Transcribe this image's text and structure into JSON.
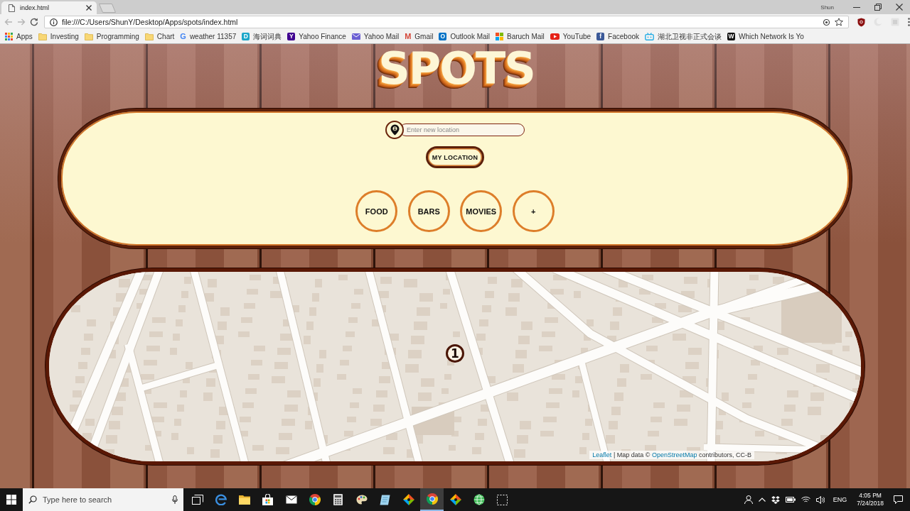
{
  "browser": {
    "tab": {
      "title": "index.html"
    },
    "profile": "Shun",
    "address": "file:///C:/Users/ShunY/Desktop/Apps/spots/index.html",
    "bookmarks": [
      {
        "label": "Apps",
        "kind": "grid"
      },
      {
        "label": "Investing",
        "kind": "folder"
      },
      {
        "label": "Programming",
        "kind": "folder"
      },
      {
        "label": "Chart",
        "kind": "folder"
      },
      {
        "label": "weather 11357",
        "kind": "letter",
        "glyph": "G",
        "color": "#4285f4"
      },
      {
        "label": "海词词典",
        "kind": "tile",
        "glyph": "D",
        "color": "#1ba6c9"
      },
      {
        "label": "Yahoo Finance",
        "kind": "tile",
        "glyph": "Y",
        "color": "#400090"
      },
      {
        "label": "Yahoo Mail",
        "kind": "envelope",
        "color": "#6b5fd3"
      },
      {
        "label": "Gmail",
        "kind": "letter",
        "glyph": "M",
        "color": "#d44638"
      },
      {
        "label": "Outlook Mail",
        "kind": "tile",
        "glyph": "O",
        "color": "#0072c6"
      },
      {
        "label": "Baruch Mail",
        "kind": "squares"
      },
      {
        "label": "YouTube",
        "kind": "play",
        "color": "#e62117"
      },
      {
        "label": "Facebook",
        "kind": "tile",
        "glyph": "f",
        "color": "#3b5998"
      },
      {
        "label": "湖北卫视非正式会谈",
        "kind": "tv",
        "color": "#23ade5"
      },
      {
        "label": "Which Network Is Yo",
        "kind": "tile",
        "glyph": "W",
        "color": "#111111"
      }
    ]
  },
  "page": {
    "title": "SPOTS",
    "search": {
      "placeholder": "Enter new location"
    },
    "locate_button": "MY LOCATION",
    "categories": [
      {
        "label": "FOOD"
      },
      {
        "label": "BARS"
      },
      {
        "label": "MOVIES"
      },
      {
        "label": "+"
      }
    ],
    "map": {
      "markers": [
        {
          "label": "1"
        }
      ],
      "attribution": [
        {
          "kind": "link",
          "text": "Leaflet"
        },
        {
          "kind": "text",
          "text": "| Map data ©"
        },
        {
          "kind": "link",
          "text": "OpenStreetMap"
        },
        {
          "kind": "text",
          "text": "contributors, CC-B"
        }
      ]
    }
  },
  "taskbar": {
    "search": {
      "placeholder": "Type here to search"
    },
    "apps": [
      {
        "kind": "taskview",
        "selected": false
      },
      {
        "kind": "edge",
        "selected": false
      },
      {
        "kind": "folder",
        "selected": false
      },
      {
        "kind": "store",
        "selected": false
      },
      {
        "kind": "mail",
        "selected": false
      },
      {
        "kind": "chrome",
        "selected": false
      },
      {
        "kind": "calculator",
        "selected": false
      },
      {
        "kind": "paint",
        "selected": false
      },
      {
        "kind": "notes",
        "selected": false
      },
      {
        "kind": "diamond",
        "selected": false
      },
      {
        "kind": "chrome",
        "selected": true
      },
      {
        "kind": "diamond",
        "selected": false
      },
      {
        "kind": "globe",
        "selected": false
      },
      {
        "kind": "snip",
        "selected": false
      }
    ],
    "tray": {
      "language": "ENG",
      "time": "4:05 PM",
      "date": "7/24/2018"
    }
  }
}
